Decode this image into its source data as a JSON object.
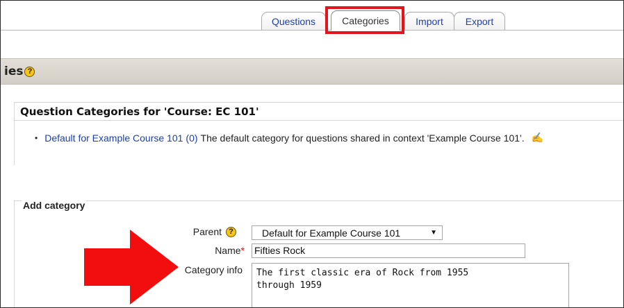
{
  "tabs": [
    {
      "label": "Questions",
      "active": false
    },
    {
      "label": "Categories",
      "active": true
    },
    {
      "label": "Import",
      "active": false
    },
    {
      "label": "Export",
      "active": false
    }
  ],
  "header": {
    "title_fragment": "ies",
    "help_glyph": "?"
  },
  "categories_section": {
    "title": "Question Categories for 'Course: EC 101'",
    "items": [
      {
        "bullet": "•",
        "name": "Default for Example Course 101",
        "count": "(0)",
        "description": "The default category for questions shared in context 'Example Course 101'.",
        "edit_icon": "✍"
      }
    ]
  },
  "add_category": {
    "legend": "Add category",
    "parent_label": "Parent",
    "parent_value": "Default for Example Course 101",
    "name_label": "Name",
    "required_marker": "*",
    "name_value": "Fifties Rock",
    "info_label": "Category info",
    "info_value": "The first classic era of Rock from 1955\nthrough 1959"
  },
  "icons": {
    "help": "help-icon",
    "edit": "edit-icon",
    "dropdown": "chevron-down-icon",
    "annotation": "arrow-right-icon"
  },
  "colors": {
    "link": "#1a3fb5",
    "highlight": "#e3141c",
    "header_bg": "#d8d4cc",
    "help_icon": "#f6c515"
  }
}
